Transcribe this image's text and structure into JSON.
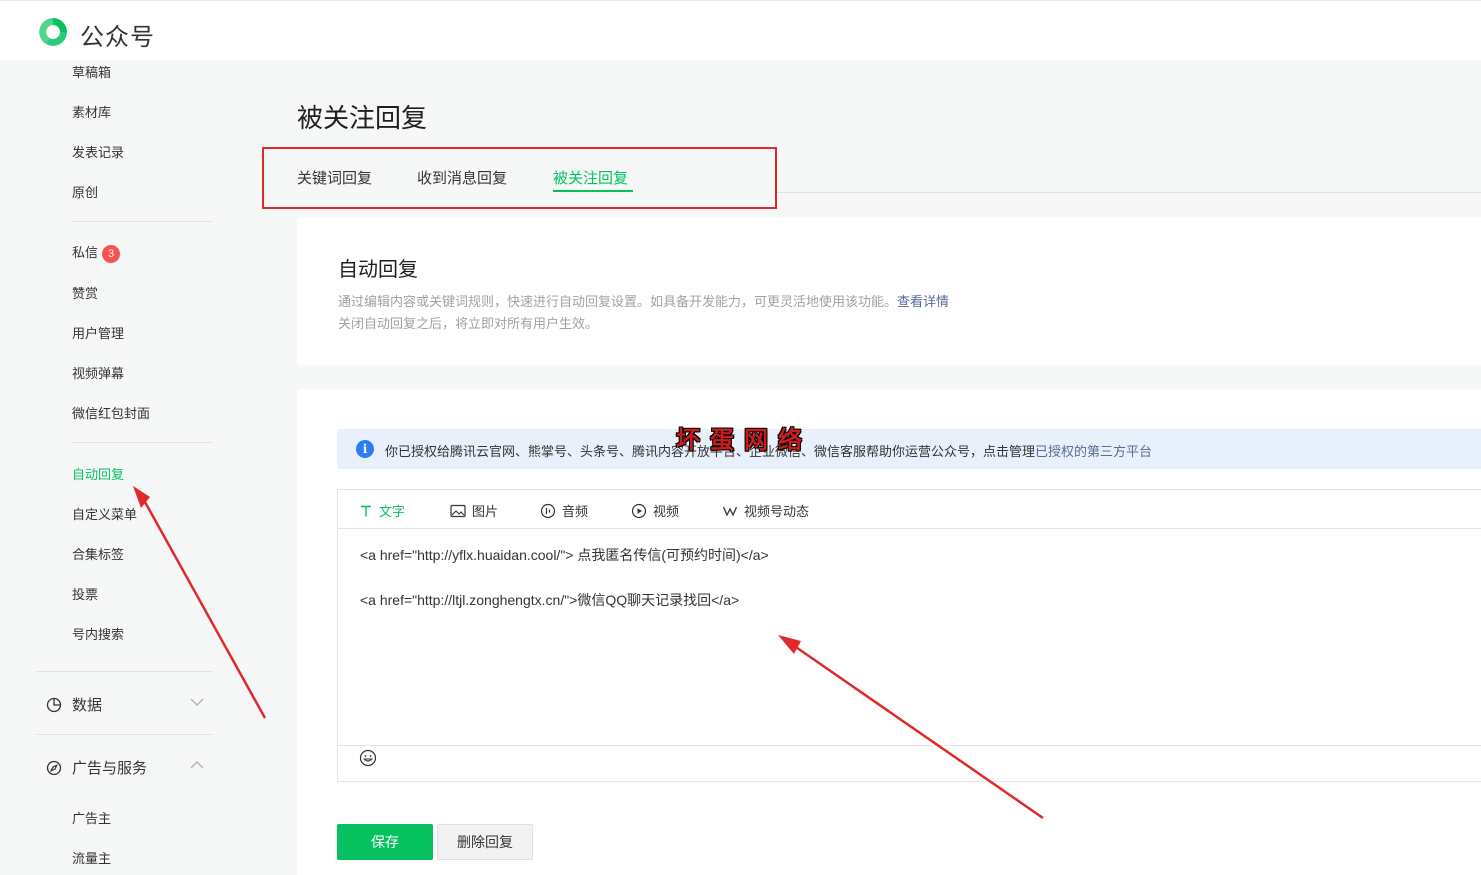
{
  "brand": {
    "name": "公众号"
  },
  "sidebar": {
    "items_top": [
      "草稿箱",
      "素材库",
      "发表记录",
      "原创"
    ],
    "items_mid": [
      "私信",
      "赞赏",
      "用户管理",
      "视频弹幕",
      "微信红包封面"
    ],
    "unread_badge": "3",
    "items_func": [
      "自动回复",
      "自定义菜单",
      "合集标签",
      "投票",
      "号内搜索"
    ],
    "active_item": "自动回复",
    "group_data": "数据",
    "group_ads": "广告与服务",
    "items_ads": [
      "广告主",
      "流量主"
    ]
  },
  "page": {
    "title": "被关注回复",
    "tabs": [
      "关键词回复",
      "收到消息回复",
      "被关注回复"
    ],
    "active_tab": "被关注回复"
  },
  "auto_reply": {
    "title": "自动回复",
    "desc1": "通过编辑内容或关键词规则，快速进行自动回复设置。如具备开发能力，可更灵活地使用该功能。",
    "desc1_link": "查看详情",
    "desc2": "关闭自动回复之后，将立即对所有用户生效。"
  },
  "watermark": "坏蛋网络",
  "notice": {
    "text": "你已授权给腾讯云官网、熊掌号、头条号、腾讯内容开放平台、企业微信、微信客服帮助你运营公众号，点击管理",
    "link": "已授权的第三方平台"
  },
  "editor": {
    "tools": [
      "文字",
      "图片",
      "音频",
      "视频",
      "视频号动态"
    ],
    "active_tool": "文字",
    "lines": [
      "<a href=\"http://yflx.huaidan.cool/\"> 点我匿名传信(可预约时间)</a>",
      "<a href=\"http://ltjl.zonghengtx.cn/\">微信QQ聊天记录找回</a>"
    ]
  },
  "buttons": {
    "save": "保存",
    "delete": "删除回复"
  },
  "colors": {
    "accent": "#07c160",
    "annotation_red": "#e02a2a",
    "link": "#576b95",
    "notice_bg": "#e8f0fb"
  }
}
